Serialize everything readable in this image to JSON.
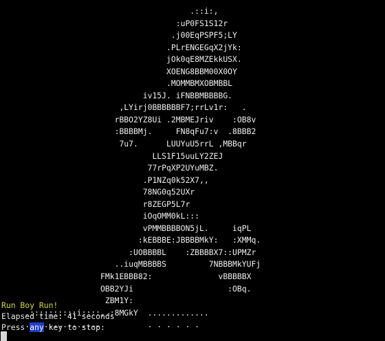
{
  "art_lines": [
    "                                        .::i:,",
    "                                     :uP0FS1S12r",
    "                                    .j00EqPSPF5;LY",
    "                                   .PLrENGEGqX2jYk:",
    "                                   jOk0qE8MZEkkUSX.",
    "                                   XOENG8BBM00X0OY",
    "                                   .MOMMBMXOBMBBL",
    "                              iv15J. iFNBBMBBBBG.",
    "                         ,LYirj0BBBBBBF7;rrLv1r:   .",
    "                        rBBO2YZ8Ui .2MBMEJriv    :OB8v",
    "                        :BBBBMj.     FN8qFu7:v  .8BBB2",
    "                         7u7.      LUUYuU5rrL ,MBBqr",
    "                                LLS1F15uuLY2ZEJ",
    "                               77rPqXP2UYuMBZ.",
    "                              .P1NZq0k52X7,,",
    "                              78NG0q52UXr",
    "                              r8ZEGP5L7r",
    "                              iOqOMM0kL:::",
    "                              vPMMBBBBON5jL.     iqPL",
    "                             :kEBBBE:JBBBBMkY:   :XMMq.",
    "                           :UOBBBBL    :ZBBBBX7::UPMZr",
    "                        ..iuqMBBBBS         7NBBBMkYUFj",
    "                     FMk1EBBB82:              vBBBBBX",
    "                     OBB2YJi                    :OBq.",
    "                      ZBM1Y:",
    "     .::::::::::i::::,.:8MGkY  .............",
    "     .................         . . . . . ."
  ],
  "status": {
    "title": "Run Boy Run!",
    "elapsed": "Elapsed time: 41 seconds",
    "press_prefix": "Press ",
    "press_highlight": "any",
    "press_suffix": " key to stop."
  },
  "colors": {
    "background": "#000000",
    "text": "#e8e8e8",
    "title": "#d8d838",
    "highlight": "#1f3ec8"
  }
}
